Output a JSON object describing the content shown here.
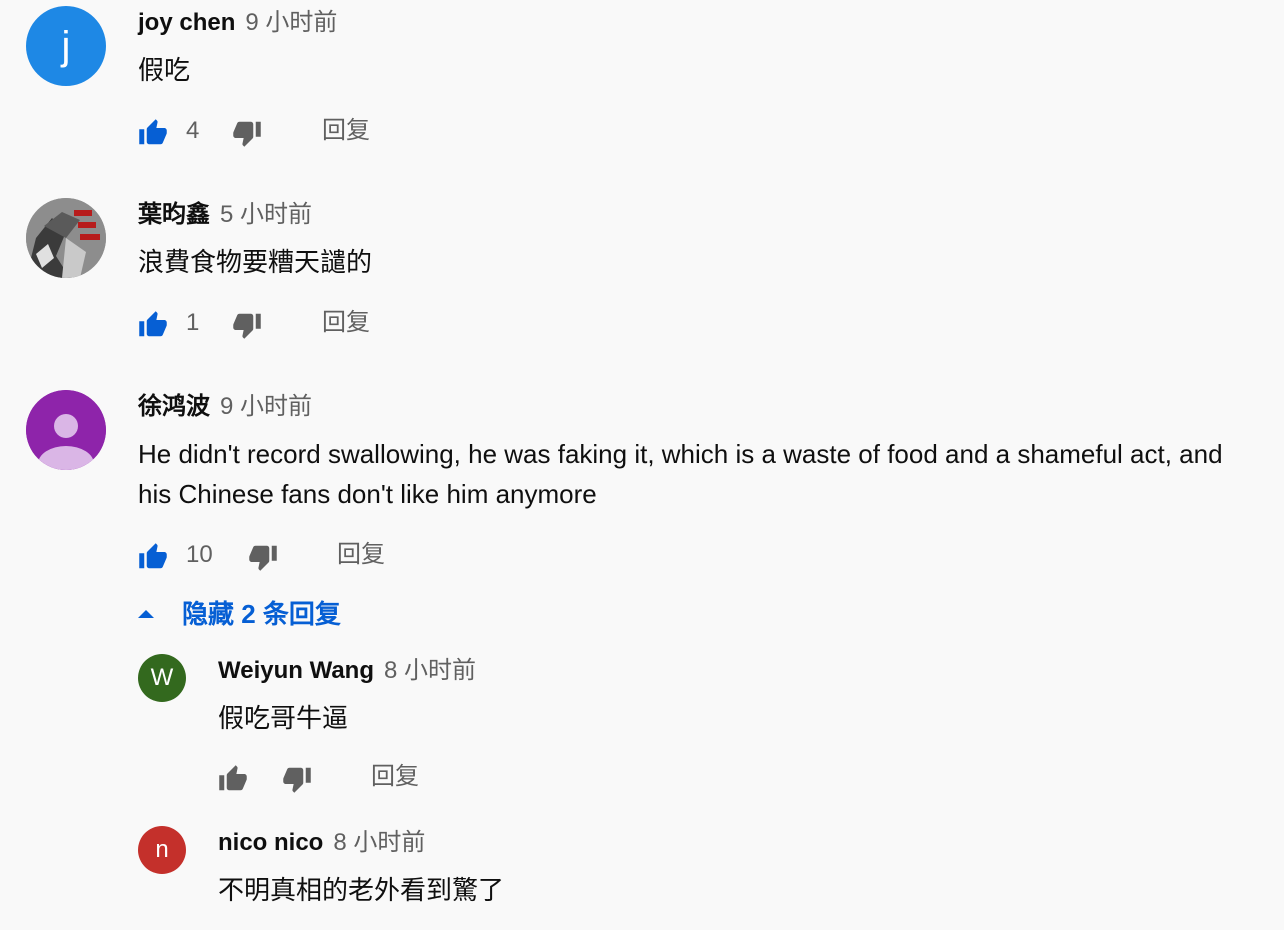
{
  "colors": {
    "like_active": "#065fd4",
    "icon_gray": "#606060",
    "link_blue": "#065fd4"
  },
  "comments": [
    {
      "author": "joy chen",
      "time": "9 小时前",
      "text": "假吃",
      "likes": "4",
      "reply_label": "回复",
      "avatar": {
        "letter": "j",
        "bg": "#1e88e5"
      }
    },
    {
      "author": "葉昀鑫",
      "time": "5 小时前",
      "text": "浪費食物要糟天譴的",
      "likes": "1",
      "reply_label": "回复",
      "avatar": {
        "letter": "",
        "bg": "#9e9e9e"
      }
    },
    {
      "author": "徐鸿波",
      "time": "9 小时前",
      "text": "He didn't record swallowing, he was faking it, which is a waste of food and a shameful act, and his Chinese fans don't like him anymore",
      "likes": "10",
      "reply_label": "回复",
      "avatar": {
        "letter": "",
        "bg": "#8e24aa"
      }
    }
  ],
  "replies_toggle": {
    "label": "隐藏 2 条回复"
  },
  "replies": [
    {
      "author": "Weiyun Wang",
      "time": "8 小时前",
      "text": "假吃哥牛逼",
      "reply_label": "回复",
      "avatar": {
        "letter": "W",
        "bg": "#33691e"
      }
    },
    {
      "author": "nico nico",
      "time": "8 小时前",
      "text": "不明真相的老外看到驚了",
      "avatar": {
        "letter": "n",
        "bg": "#c4302b"
      }
    }
  ]
}
